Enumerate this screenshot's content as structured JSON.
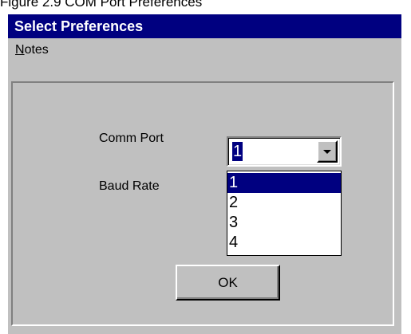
{
  "caption": "Figure 2.9 COM Port Preferences",
  "window": {
    "title": "Select Preferences"
  },
  "menu": {
    "notes_mnemonic": "N",
    "notes_rest": "otes"
  },
  "form": {
    "comm_port_label": "Comm Port",
    "comm_port_value": "1",
    "baud_rate_label": "Baud Rate",
    "comm_port_options": [
      "1",
      "2",
      "3",
      "4"
    ],
    "selected_option": "1",
    "ok_label": "OK"
  },
  "icons": {
    "dropdown_button": "chevron-down-icon"
  },
  "colors": {
    "title_bar": "#000080",
    "dialog_face": "#c0c0c0",
    "selection": "#000080"
  }
}
